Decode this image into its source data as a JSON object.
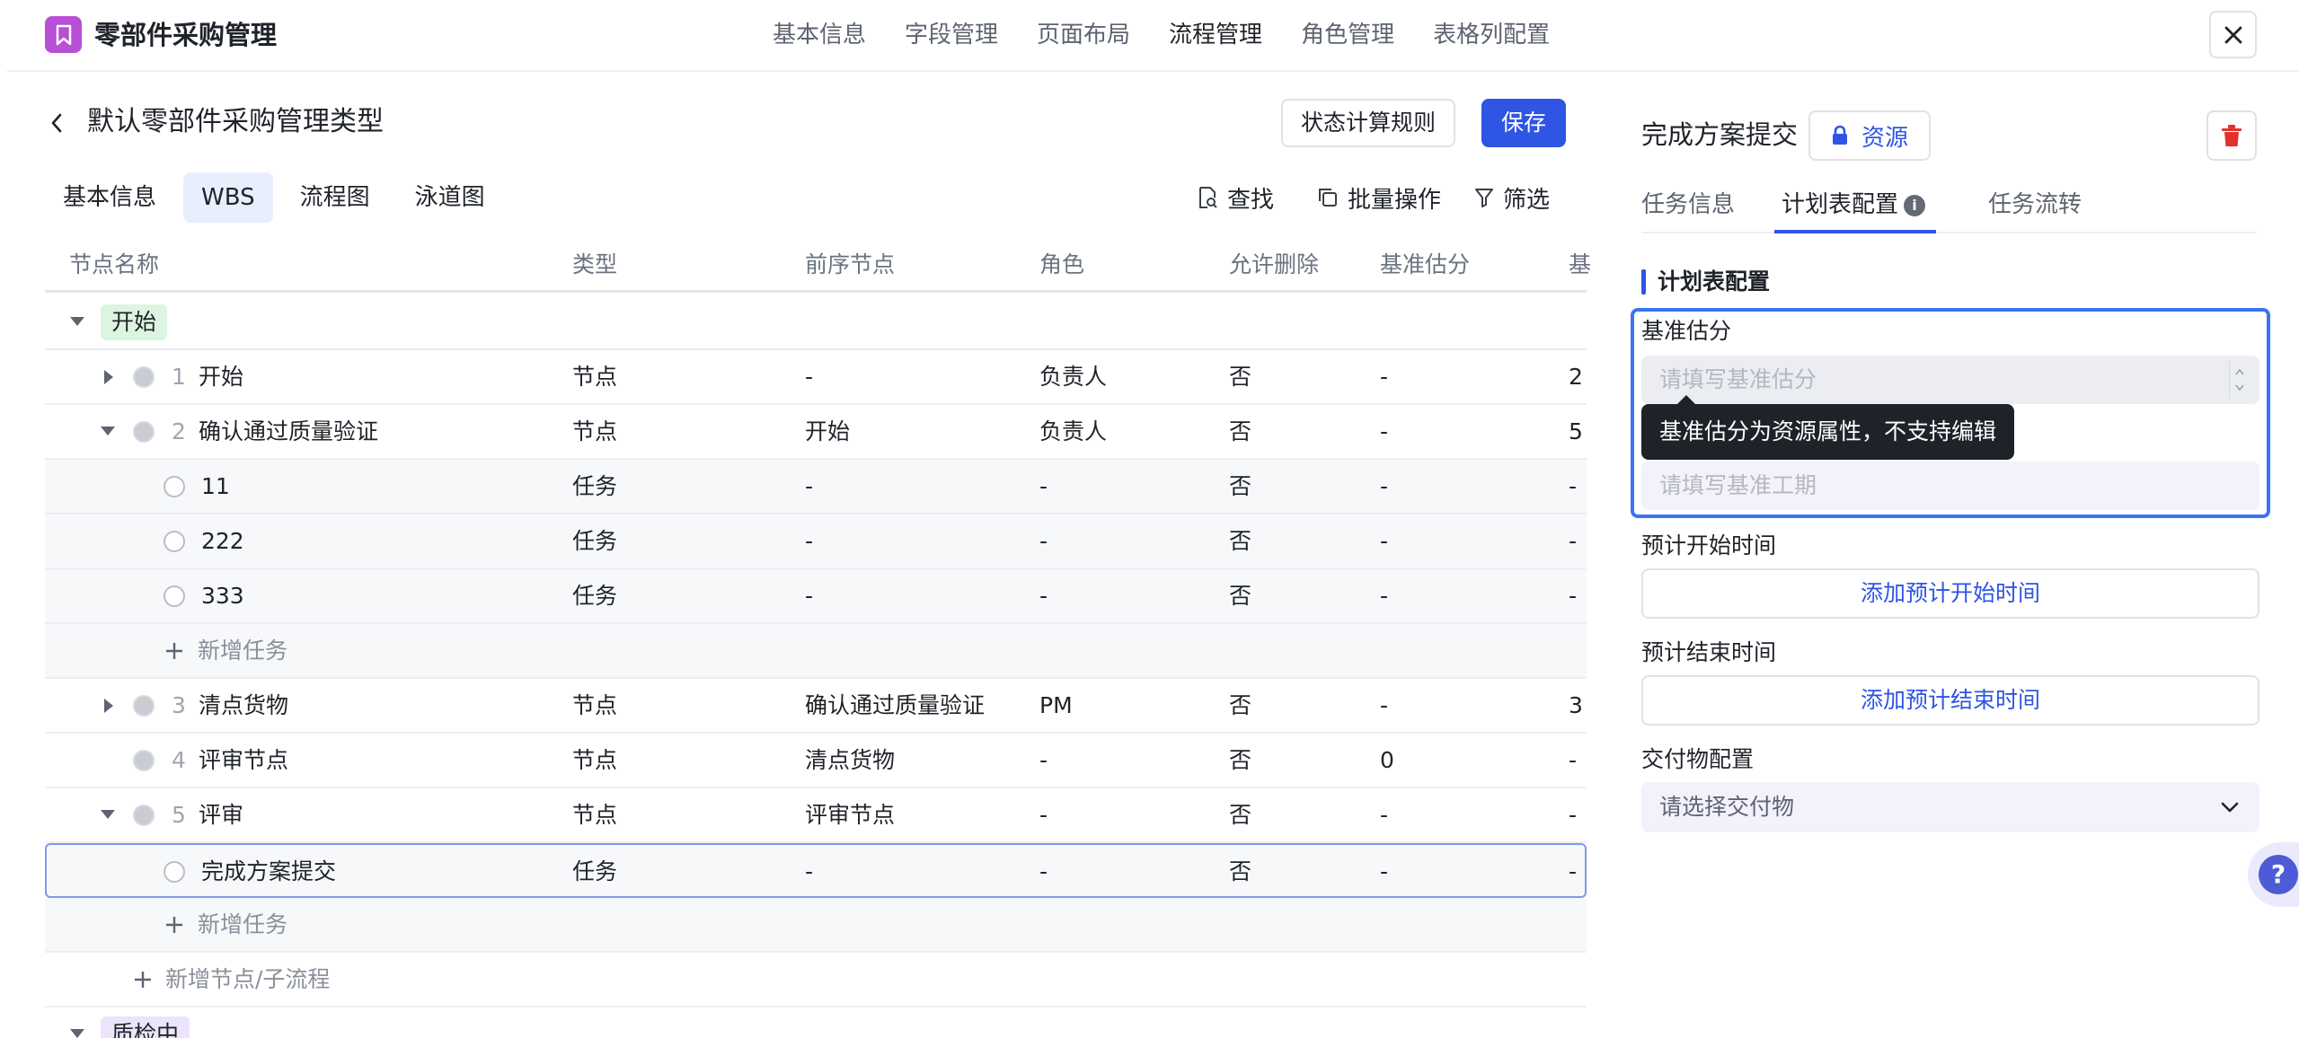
{
  "app": {
    "title": "零部件采购管理",
    "nav": [
      "基本信息",
      "字段管理",
      "页面布局",
      "流程管理",
      "角色管理",
      "表格列配置"
    ],
    "nav_active": "流程管理"
  },
  "page": {
    "title": "默认零部件采购管理类型",
    "rule_button": "状态计算规则",
    "save_button": "保存",
    "tabs": [
      "基本信息",
      "WBS",
      "流程图",
      "泳道图"
    ],
    "active_tab": "WBS",
    "tools": {
      "find": "查找",
      "batch": "批量操作",
      "filter": "筛选"
    }
  },
  "table": {
    "columns": [
      "节点名称",
      "类型",
      "前序节点",
      "角色",
      "允许删除",
      "基准估分",
      "基"
    ],
    "groups": [
      {
        "label": "开始",
        "color": "#dcf5e1"
      },
      {
        "label": "质检中",
        "color": "#ebe4fb"
      }
    ],
    "rows": [
      {
        "index": "1",
        "name": "开始",
        "type": "节点",
        "prev": "-",
        "role": "负责人",
        "deletable": "否",
        "estimate": "-",
        "extra": "2"
      },
      {
        "index": "2",
        "name": "确认通过质量验证",
        "type": "节点",
        "prev": "开始",
        "role": "负责人",
        "deletable": "否",
        "estimate": "-",
        "extra": "5"
      },
      {
        "name": "11",
        "type": "任务",
        "prev": "-",
        "role": "-",
        "deletable": "否",
        "estimate": "-",
        "extra": "-"
      },
      {
        "name": "222",
        "type": "任务",
        "prev": "-",
        "role": "-",
        "deletable": "否",
        "estimate": "-",
        "extra": "-"
      },
      {
        "name": "333",
        "type": "任务",
        "prev": "-",
        "role": "-",
        "deletable": "否",
        "estimate": "-",
        "extra": "-"
      },
      {
        "index": "3",
        "name": "清点货物",
        "type": "节点",
        "prev": "确认通过质量验证",
        "role": "PM",
        "deletable": "否",
        "estimate": "-",
        "extra": "3"
      },
      {
        "index": "4",
        "name": "评审节点",
        "type": "节点",
        "prev": "清点货物",
        "role": "-",
        "deletable": "否",
        "estimate": "0",
        "extra": "-"
      },
      {
        "index": "5",
        "name": "评审",
        "type": "节点",
        "prev": "评审节点",
        "role": "-",
        "deletable": "否",
        "estimate": "-",
        "extra": "-"
      },
      {
        "name": "完成方案提交",
        "type": "任务",
        "prev": "-",
        "role": "-",
        "deletable": "否",
        "estimate": "-",
        "extra": "-"
      }
    ],
    "add_task": "新增任务",
    "add_node": "新增节点/子流程"
  },
  "panel": {
    "title": "完成方案提交",
    "resource_chip": "资源",
    "tabs": [
      "任务信息",
      "计划表配置",
      "任务流转"
    ],
    "active_tab": "计划表配置",
    "section": "计划表配置",
    "estimate_label": "基准估分",
    "estimate_placeholder": "请填写基准估分",
    "tooltip": "基准估分为资源属性，不支持编辑",
    "duration_placeholder": "请填写基准工期",
    "start_label": "预计开始时间",
    "start_button": "添加预计开始时间",
    "end_label": "预计结束时间",
    "end_button": "添加预计结束时间",
    "deliverable_label": "交付物配置",
    "deliverable_placeholder": "请选择交付物"
  },
  "colors": {
    "primary": "#2f55e4",
    "logo": "#b84fd6",
    "danger": "#e0312c",
    "focus": "#3b74f2"
  },
  "icons": [
    "bookmark-icon",
    "close-icon",
    "back-chevron-icon",
    "search-doc-icon",
    "copy-icon",
    "filter-icon",
    "lock-icon",
    "trash-icon",
    "info-icon",
    "plus-icon",
    "chevron-down-icon",
    "help-icon"
  ]
}
